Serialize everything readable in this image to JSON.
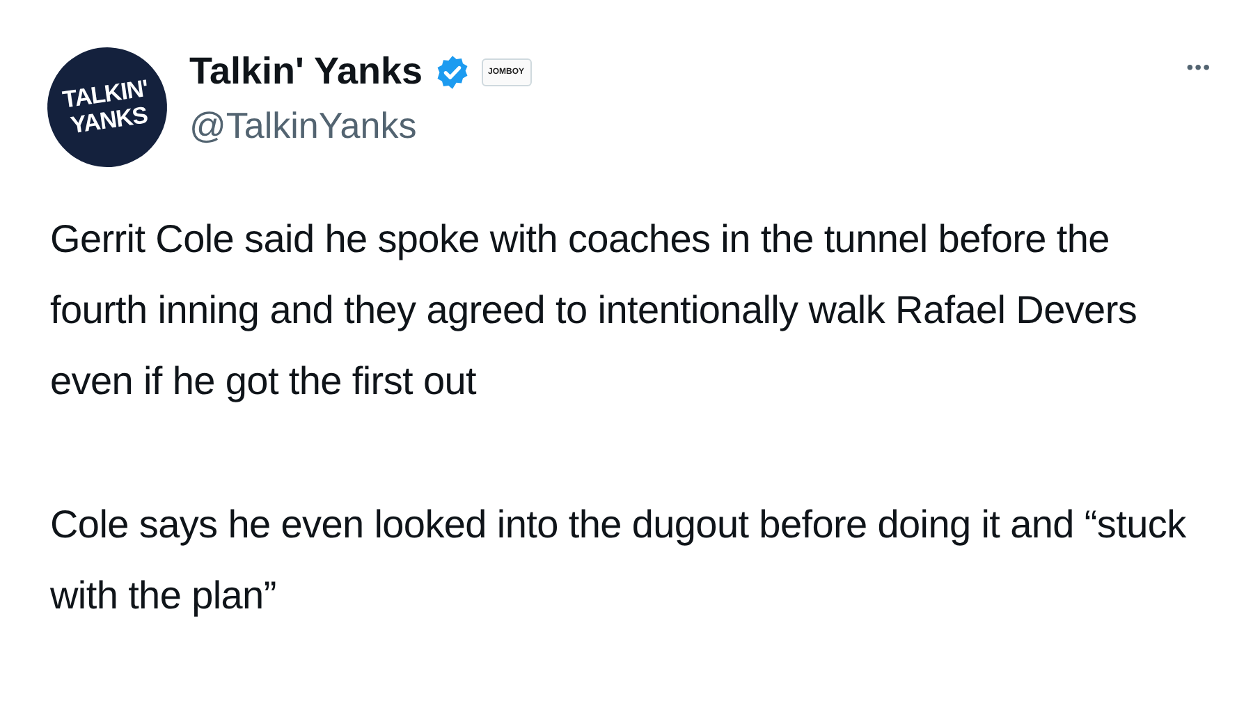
{
  "author": {
    "avatar_lines": [
      "TALKIN'",
      "YANKS"
    ],
    "name": "Talkin' Yanks",
    "verified": true,
    "affiliate_badge": "JOMBOY",
    "handle": "@TalkinYanks"
  },
  "more_button": "•••",
  "paragraphs": [
    "Gerrit Cole said he spoke with coaches in the tunnel before the fourth inning and they agreed to intentionally walk Rafael Devers even if he got the first out",
    "Cole says he even looked into the dugout before doing it and “stuck with the plan”"
  ]
}
